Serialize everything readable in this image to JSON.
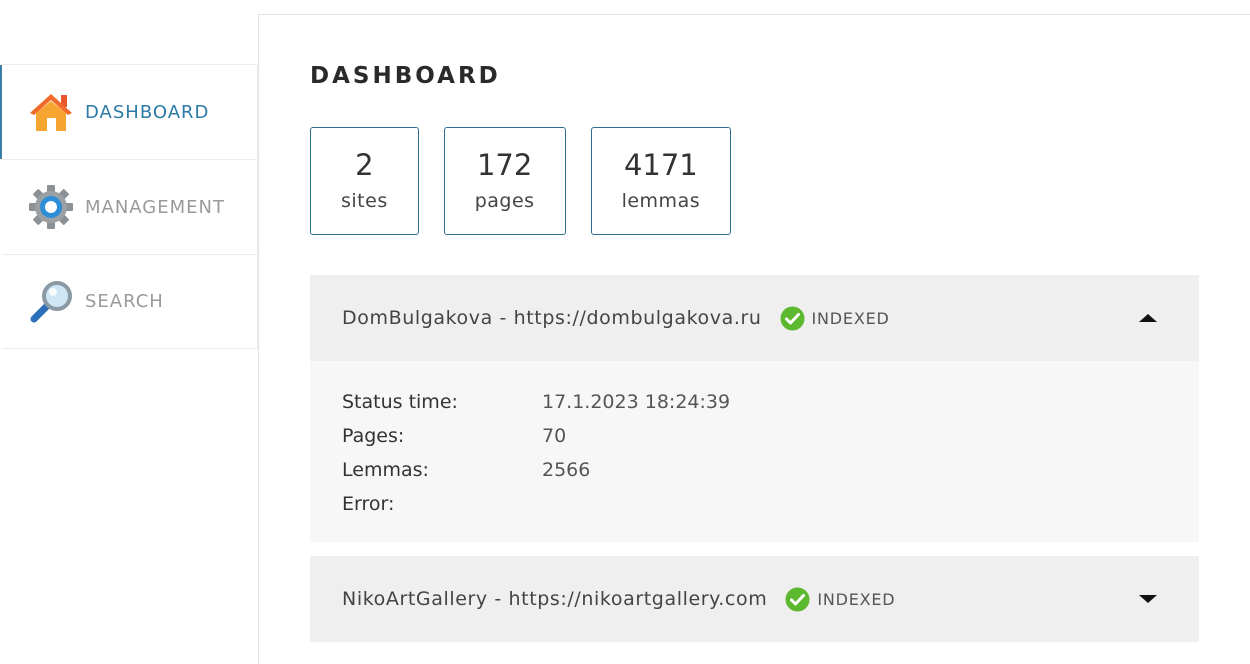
{
  "sidebar": {
    "items": [
      {
        "label": "DASHBOARD",
        "icon": "home-icon",
        "active": true
      },
      {
        "label": "MANAGEMENT",
        "icon": "gear-icon",
        "active": false
      },
      {
        "label": "SEARCH",
        "icon": "magnifier-icon",
        "active": false
      }
    ]
  },
  "main": {
    "title": "DASHBOARD",
    "stats": [
      {
        "value": "2",
        "label": "sites"
      },
      {
        "value": "172",
        "label": "pages"
      },
      {
        "value": "4171",
        "label": "lemmas"
      }
    ],
    "sites": [
      {
        "name": "DomBulgakova - https://dombulgakova.ru",
        "status": "INDEXED",
        "expanded": true,
        "details": {
          "status_time_label": "Status time:",
          "status_time": "17.1.2023 18:24:39",
          "pages_label": "Pages:",
          "pages": "70",
          "lemmas_label": "Lemmas:",
          "lemmas": "2566",
          "error_label": "Error:",
          "error": ""
        }
      },
      {
        "name": "NikoArtGallery - https://nikoartgallery.com",
        "status": "INDEXED",
        "expanded": false
      }
    ]
  },
  "colors": {
    "accent": "#2b7aa8",
    "status_ok": "#5cb82e",
    "header_bg": "#efefef",
    "details_bg": "#f7f7f7"
  }
}
